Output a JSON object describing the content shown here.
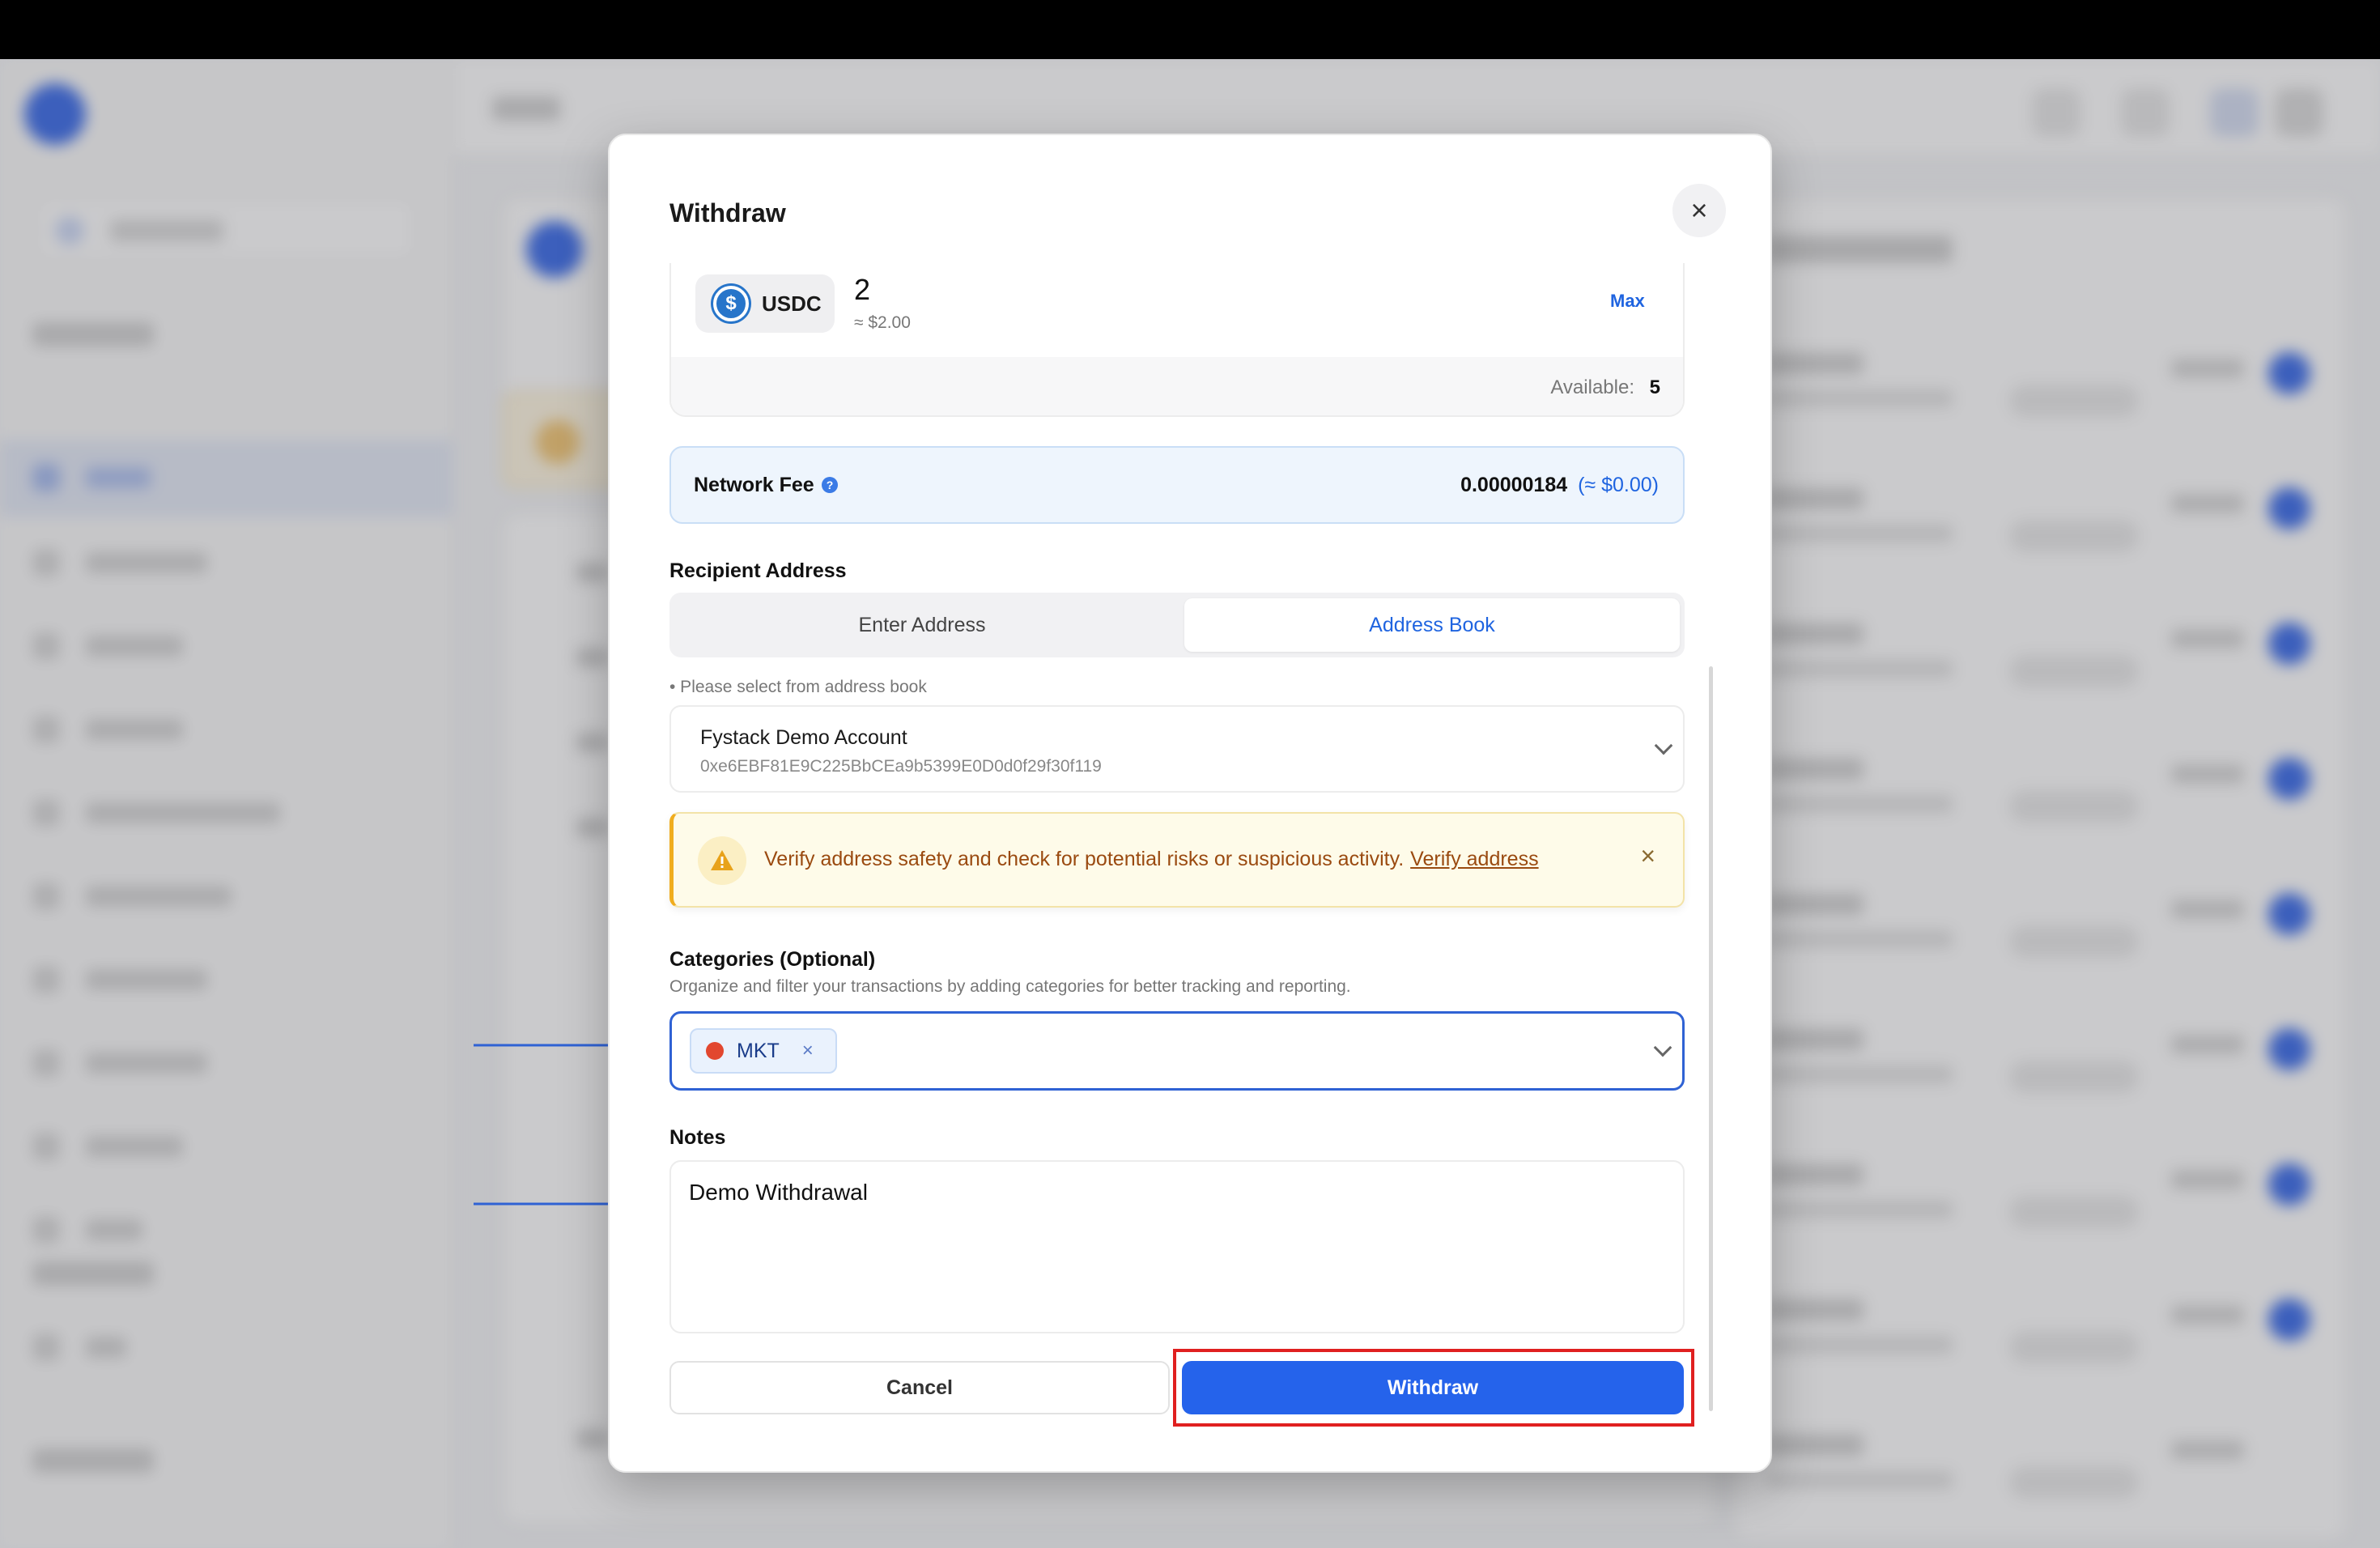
{
  "modal": {
    "title": "Withdraw",
    "close_icon": "close-icon"
  },
  "amount": {
    "token": "USDC",
    "token_icon": "usdc-coin-icon",
    "value": "2",
    "usd": "≈ $2.00",
    "max_label": "Max",
    "available_label": "Available:",
    "available_value": "5"
  },
  "fee": {
    "label": "Network Fee",
    "info_icon": "question-icon",
    "value": "0.00000184",
    "usd": "(≈ $0.00)"
  },
  "recipient": {
    "label": "Recipient Address",
    "tabs": [
      {
        "label": "Enter Address",
        "active": false
      },
      {
        "label": "Address Book",
        "active": true
      }
    ],
    "hint": "• Please select from address book",
    "selected_name": "Fystack Demo Account",
    "selected_address": "0xe6EBF81E9C225BbCEa9b5399E0D0d0f29f30f119"
  },
  "warning": {
    "text": "Verify address safety and check for potential risks or suspicious activity.",
    "link": "Verify address",
    "icon": "warning-triangle-icon",
    "close": "×"
  },
  "categories": {
    "label": "Categories (Optional)",
    "description": "Organize and filter your transactions by adding categories for better tracking and reporting.",
    "tags": [
      {
        "name": "MKT",
        "color": "#e2472f"
      }
    ]
  },
  "notes": {
    "label": "Notes",
    "value": "Demo Withdrawal"
  },
  "actions": {
    "cancel": "Cancel",
    "withdraw": "Withdraw"
  },
  "colors": {
    "accent": "#2563eb",
    "highlight": "#e02020",
    "annotation_arrow": "#2f62d4"
  }
}
